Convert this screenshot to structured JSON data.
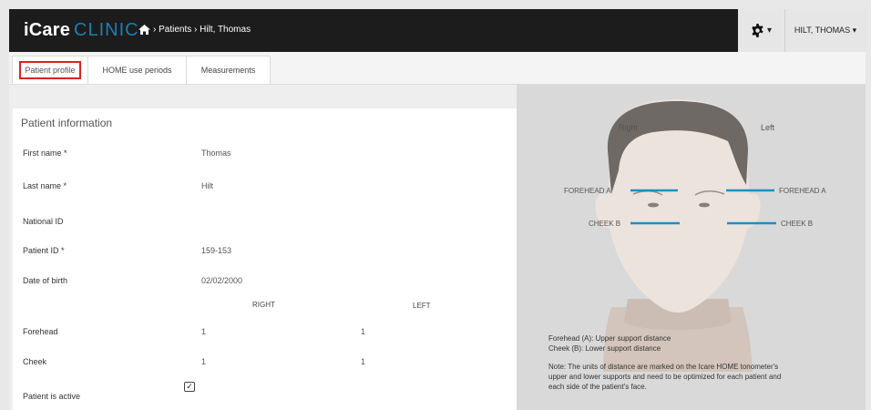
{
  "app": {
    "brand_bold": "iCare",
    "brand_light": "CLINIC"
  },
  "breadcrumb": {
    "text": "› Patients › Hilt, Thomas"
  },
  "settings": {
    "caret": "▾"
  },
  "user": {
    "name": "HILT, THOMAS ▾"
  },
  "tabs": [
    {
      "label": "Patient profile"
    },
    {
      "label": "HOME use periods"
    },
    {
      "label": "Measurements"
    }
  ],
  "patient": {
    "title": "Patient information",
    "fields": [
      {
        "label": "First name *",
        "value": "Thomas"
      },
      {
        "label": "Last name *",
        "value": "Hilt"
      },
      {
        "label": "National ID",
        "value": ""
      },
      {
        "label": "Patient ID *",
        "value": "159-153"
      },
      {
        "label": "Date of birth",
        "value": "02/02/2000"
      }
    ],
    "col_right": "RIGHT",
    "col_left": "LEFT",
    "forehead": {
      "label": "Forehead",
      "right": "1",
      "left": "1"
    },
    "cheek": {
      "label": "Cheek",
      "right": "1",
      "left": "1"
    },
    "active": {
      "label": "Patient is active",
      "checked": true
    }
  },
  "diagram": {
    "right_label": "Right",
    "left_label": "Left",
    "forehead_left": "FOREHEAD A",
    "forehead_right": "FOREHEAD A",
    "cheek_left": "CHEEK B",
    "cheek_right": "CHEEK B",
    "legend_1": "Forehead (A): Upper support distance",
    "legend_2": "Cheek (B):     Lower support distance",
    "note_1": "Note: The units of distance are marked on the Icare HOME tonometer's",
    "note_2": "upper and lower supports and need to be optimized for each patient and",
    "note_3": "each side of the patient's face."
  },
  "colors": {
    "topbar": "#1c1c1c",
    "brand_accent": "#1c7fb0",
    "highlight": "#e02020",
    "measure_line": "#1b8fc5"
  }
}
